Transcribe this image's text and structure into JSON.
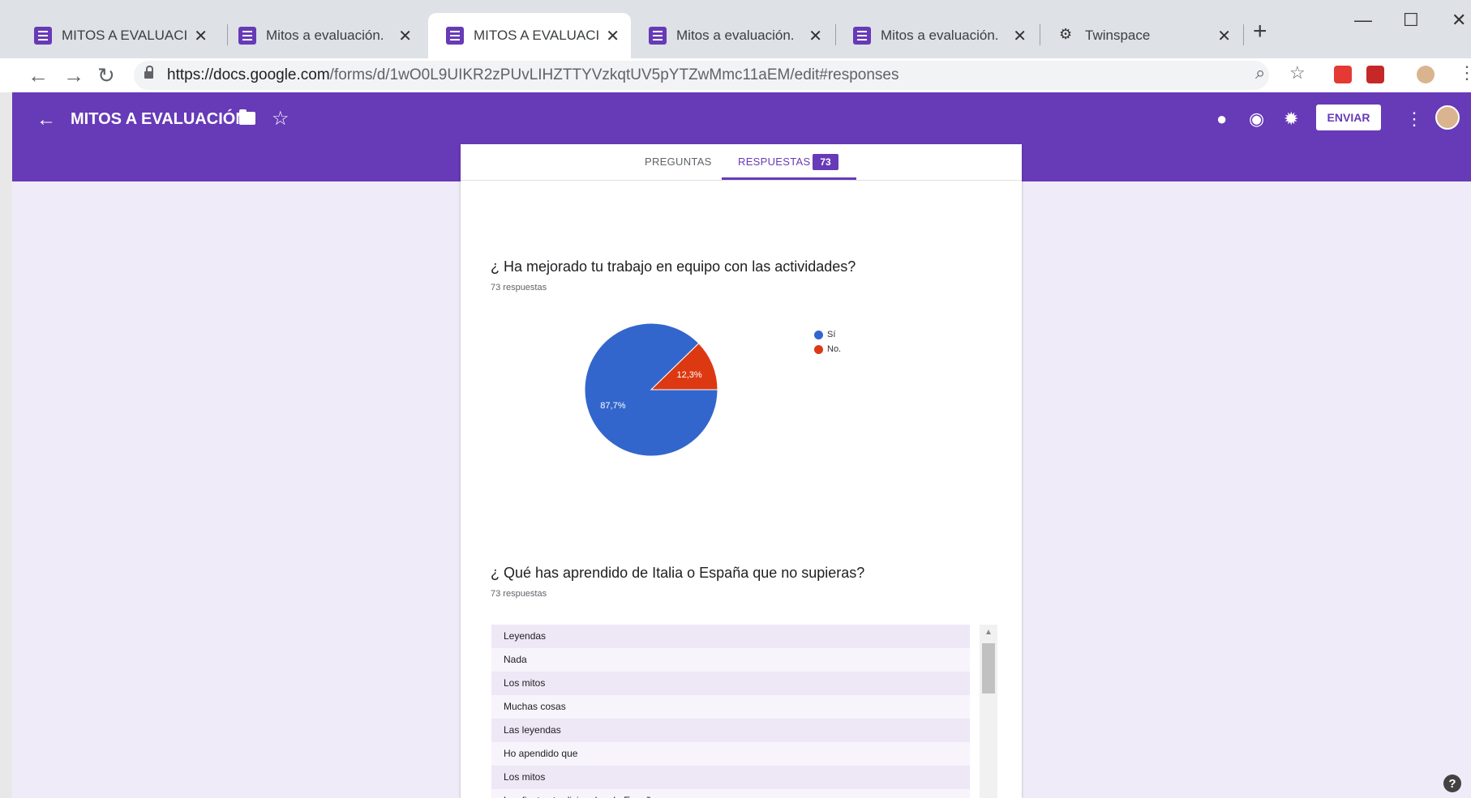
{
  "browser": {
    "tabs": [
      {
        "title": "MITOS A EVALUACIÓN.",
        "icon": "forms-icon"
      },
      {
        "title": "Mitos a evaluación.",
        "icon": "forms-icon"
      },
      {
        "title": "MITOS A EVALUACIÓN.",
        "icon": "forms-icon"
      },
      {
        "title": "Mitos a evaluación.",
        "icon": "forms-icon"
      },
      {
        "title": "Mitos a evaluación.",
        "icon": "forms-icon"
      },
      {
        "title": "Twinspace",
        "icon": "twinspace-icon"
      }
    ],
    "active_tab": 2,
    "close_glyph": "✕",
    "new_tab": "+",
    "url_host": "https://docs.google.com",
    "url_path": "/forms/d/1wO0L9UIKR2zPUvLIHZTTYVzkqtUV5pYTZwMmc11aEM/edit#responses",
    "window_controls": {
      "minimize": "—",
      "maximize": "☐",
      "close": "✕"
    }
  },
  "header": {
    "back": "←",
    "title": "MITOS A EVALUACIÓN.",
    "star": "☆",
    "send_label": "ENVIAR",
    "more": "⋮"
  },
  "form_tabs": {
    "questions": "PREGUNTAS",
    "responses": "RESPUESTAS",
    "response_count": "73"
  },
  "questions": [
    {
      "title": "¿ Ha mejorado tu trabajo en equipo con las actividades?",
      "subtitle": "73 respuestas"
    },
    {
      "title": "¿ Qué has aprendido de Italia o España que no supieras?",
      "subtitle": "73 respuestas",
      "responses": [
        "Leyendas",
        "Nada",
        "Los mitos",
        "Muchas cosas",
        "Las leyendas",
        "Ho apendido que",
        "Los mitos",
        "Las fiestas tradicionales de España"
      ]
    }
  ],
  "chart_data": {
    "type": "pie",
    "categories": [
      "Sí",
      "No."
    ],
    "values": [
      87.7,
      12.3
    ],
    "value_labels": [
      "87,7%",
      "12,3%"
    ],
    "colors": [
      "#3366cc",
      "#dc3912"
    ],
    "legend_position": "right"
  },
  "help": "?"
}
